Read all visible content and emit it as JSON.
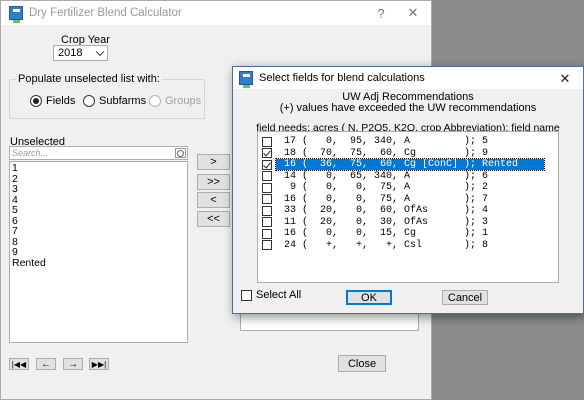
{
  "main": {
    "title": "Dry Fertilizer Blend Calculator",
    "help_glyph": "?",
    "close_glyph": "✕",
    "crop_year_label": "Crop Year",
    "crop_year_value": "2018",
    "populate_label": "Populate unselected list with:",
    "radio_fields": "Fields",
    "radio_subfarms": "Subfarms",
    "radio_groups": "Groups",
    "unselected_label": "Unselected",
    "search_placeholder": "Search...",
    "unselected_items": [
      "1",
      "2",
      "3",
      "4",
      "5",
      "6",
      "7",
      "8",
      "9",
      "Rented"
    ],
    "move_one_right": ">",
    "move_all_right": ">>",
    "move_one_left": "<",
    "move_all_left": "<<",
    "nav_first": "|◀◀",
    "nav_prev": "←",
    "nav_next": "→",
    "nav_last": "▶▶|",
    "close_button": "Close"
  },
  "dialog": {
    "title": "Select fields for blend calculations",
    "heading1": "UW Adj Recommendations",
    "heading2": "(+) values have exceeded the UW recommendations",
    "columns_hint": "field needs: acres ( N, P2O5, K2O, crop Abbreviation); field name",
    "rows": [
      {
        "text": " 17 (   0,  95, 340, A         ); 5",
        "checked": false,
        "selected": false
      },
      {
        "text": " 18 (  70,  75,  60, Cg        ); 9",
        "checked": true,
        "selected": false
      },
      {
        "text": " 16 (  36,  75,  60, Cg [ConC] ); Rented",
        "checked": true,
        "selected": true
      },
      {
        "text": " 14 (   0,  65, 340, A         ); 6",
        "checked": false,
        "selected": false
      },
      {
        "text": "  9 (   0,   0,  75, A         ); 2",
        "checked": false,
        "selected": false
      },
      {
        "text": " 16 (   0,   0,  75, A         ); 7",
        "checked": false,
        "selected": false
      },
      {
        "text": " 33 (  20,   0,  60, OfAs      ); 4",
        "checked": false,
        "selected": false
      },
      {
        "text": " 11 (  20,   0,  30, OfAs      ); 3",
        "checked": false,
        "selected": false
      },
      {
        "text": " 16 (   0,   0,  15, Cg        ); 1",
        "checked": false,
        "selected": false
      },
      {
        "text": " 24 (   +,   +,   +, Csl       ); 8",
        "checked": false,
        "selected": false
      }
    ],
    "select_all_label": "Select All",
    "ok_button": "OK",
    "cancel_button": "Cancel",
    "close_glyph": "✕"
  }
}
